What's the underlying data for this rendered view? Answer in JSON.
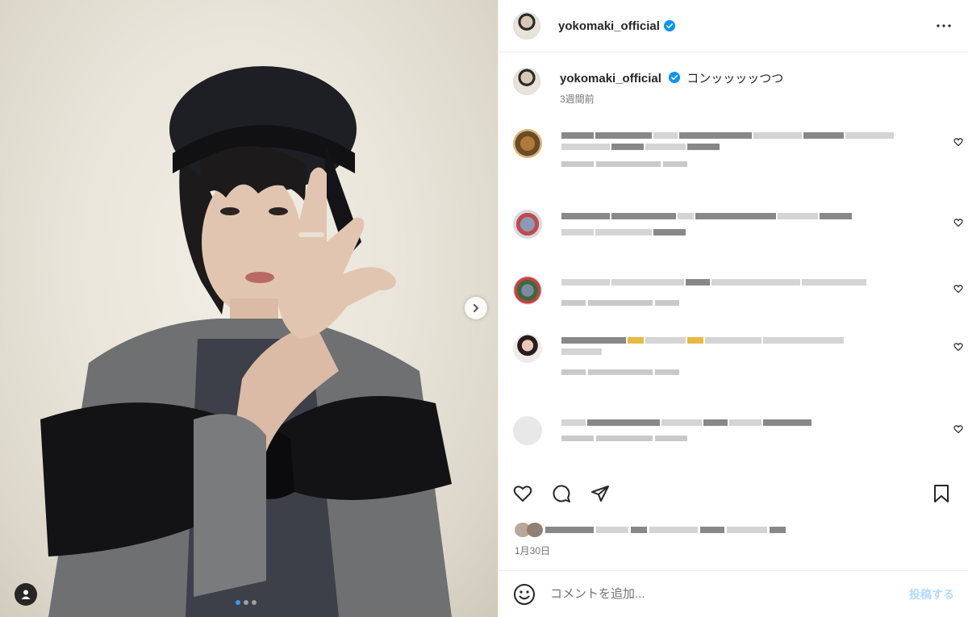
{
  "post": {
    "username": "yokomaki_official",
    "caption_text": "コンッッッッつつ",
    "caption_time": "3週間前",
    "date": "1月30日",
    "media_count": 3,
    "media_index": 1
  },
  "comment_box": {
    "placeholder": "コメントを追加...",
    "post_label": "投稿する"
  },
  "colors": {
    "verified": "#0095f6",
    "active_dot": "#3797f0",
    "post_button": "#b3dbff"
  },
  "icons": {
    "verified": "verified-badge-icon",
    "more": "more-options-icon",
    "next": "chevron-right-icon",
    "tag": "user-tag-icon",
    "like": "heart-icon",
    "comment": "comment-icon",
    "share": "share-icon",
    "save": "bookmark-icon",
    "emoji": "emoji-icon"
  }
}
